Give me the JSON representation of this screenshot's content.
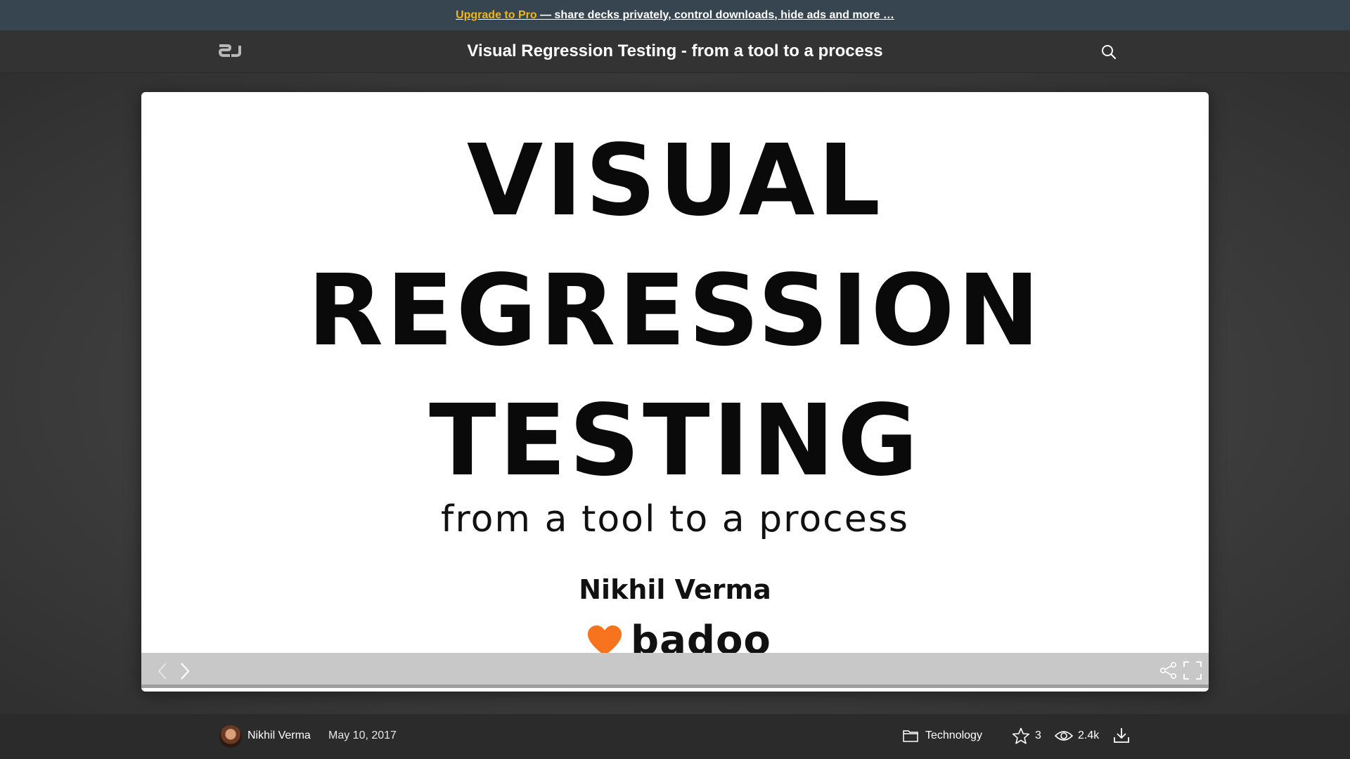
{
  "promo": {
    "upgrade_label": "Upgrade to Pro",
    "message": " — share decks privately, control downloads, hide ads and more …",
    "upgrade_color": "#f2b61b"
  },
  "header": {
    "logo_text": "SJ",
    "title": "Visual Regression Testing - from a tool to a process",
    "search_icon": "search-icon"
  },
  "slide": {
    "line1": "VISUAL",
    "line2": "REGRESSION",
    "line3": "TESTING",
    "subtitle": "from a tool to a process",
    "author": "Nikhil Verma",
    "brand_name": "badoo",
    "brand_color": "#f7731e"
  },
  "controls": {
    "prev_icon": "chevron-left-icon",
    "next_icon": "chevron-right-icon",
    "share_icon": "share-icon",
    "fullscreen_icon": "fullscreen-icon"
  },
  "footer": {
    "author": "Nikhil Verma",
    "date": "May 10, 2017",
    "category": "Technology",
    "stars": "3",
    "views": "2.4k",
    "download_icon": "download-icon"
  }
}
